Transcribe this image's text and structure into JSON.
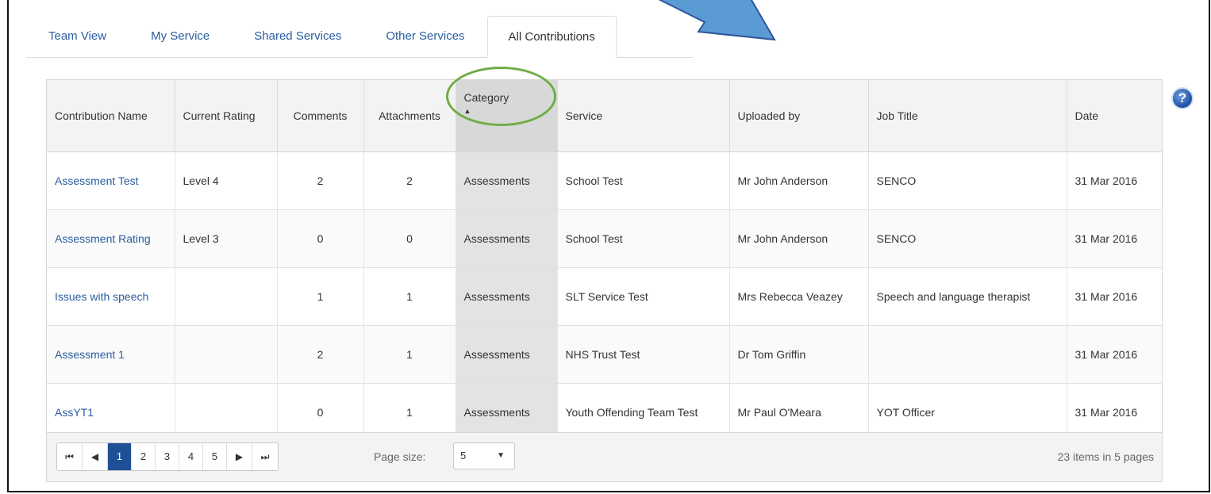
{
  "tabs": [
    "Team View",
    "My Service",
    "Shared Services",
    "Other Services",
    "All Contributions"
  ],
  "active_tab": "All Contributions",
  "columns": {
    "name": "Contribution Name",
    "rating": "Current Rating",
    "comments": "Comments",
    "attachments": "Attachments",
    "category": "Category",
    "service": "Service",
    "uploaded_by": "Uploaded by",
    "job_title": "Job Title",
    "date": "Date"
  },
  "sort_indicator": "▲",
  "rows": [
    {
      "name": "Assessment Test",
      "rating": "Level 4",
      "comments": "2",
      "attachments": "2",
      "category": "Assessments",
      "service": "School Test",
      "uploaded_by": "Mr John Anderson",
      "job_title": "SENCO",
      "date": "31 Mar 2016"
    },
    {
      "name": "Assessment Rating",
      "rating": "Level 3",
      "comments": "0",
      "attachments": "0",
      "category": "Assessments",
      "service": "School Test",
      "uploaded_by": "Mr John Anderson",
      "job_title": "SENCO",
      "date": "31 Mar 2016"
    },
    {
      "name": "Issues with speech",
      "rating": "",
      "comments": "1",
      "attachments": "1",
      "category": "Assessments",
      "service": "SLT Service Test",
      "uploaded_by": "Mrs Rebecca Veazey",
      "job_title": "Speech and language therapist",
      "date": "31 Mar 2016"
    },
    {
      "name": "Assessment 1",
      "rating": "",
      "comments": "2",
      "attachments": "1",
      "category": "Assessments",
      "service": "NHS Trust Test",
      "uploaded_by": "Dr Tom Griffin",
      "job_title": "",
      "date": "31 Mar 2016"
    },
    {
      "name": "AssYT1",
      "rating": "",
      "comments": "0",
      "attachments": "1",
      "category": "Assessments",
      "service": "Youth Offending Team Test",
      "uploaded_by": "Mr Paul O'Meara",
      "job_title": "YOT Officer",
      "date": "31 Mar 2016"
    }
  ],
  "pager": {
    "first": "⏮",
    "prev": "◀",
    "pages": [
      "1",
      "2",
      "3",
      "4",
      "5"
    ],
    "current_page": "1",
    "next": "▶",
    "last": "⏭",
    "page_size_label": "Page size:",
    "page_size_value": "5",
    "page_size_caret": "▼",
    "info": "23 items in 5 pages"
  },
  "help_icon": "question-circle-icon",
  "help_glyph": "?",
  "colors": {
    "link": "#2a5d9f",
    "active_page": "#1f4f97",
    "annotation_ring": "#70ad47",
    "annotation_arrow": "#5b9bd5"
  }
}
